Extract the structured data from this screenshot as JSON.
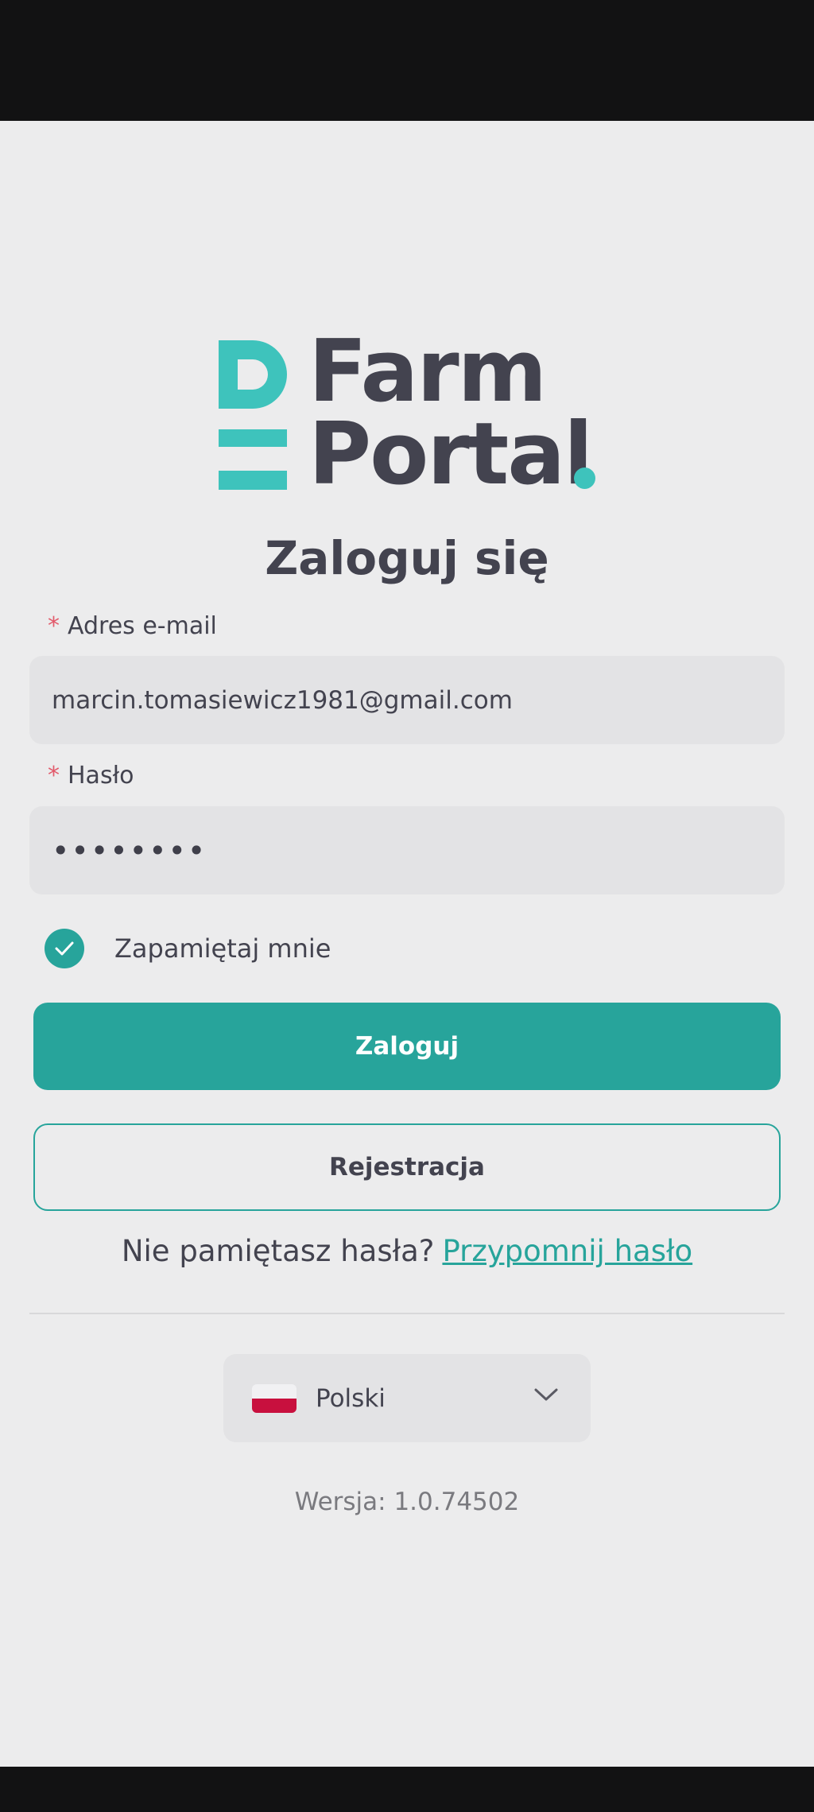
{
  "app": {
    "logo_line1": "Farm",
    "logo_line2": "Portal",
    "brand_color": "#3ec3bc",
    "accent_color": "#27a49b"
  },
  "login": {
    "title": "Zaloguj się",
    "email_label": "Adres e-mail",
    "email_value": "marcin.tomasiewicz1981@gmail.com",
    "password_label": "Hasło",
    "password_mask": "••••••••",
    "required_marker": "*",
    "remember_label": "Zapamiętaj mnie",
    "remember_checked": true,
    "submit_label": "Zaloguj",
    "register_label": "Rejestracja",
    "forgot_prompt": "Nie pamiętasz hasła?",
    "forgot_link": "Przypomnij hasło"
  },
  "language": {
    "selected": "Polski",
    "icon": "poland-flag-icon"
  },
  "footer": {
    "version": "Wersja: 1.0.74502"
  }
}
